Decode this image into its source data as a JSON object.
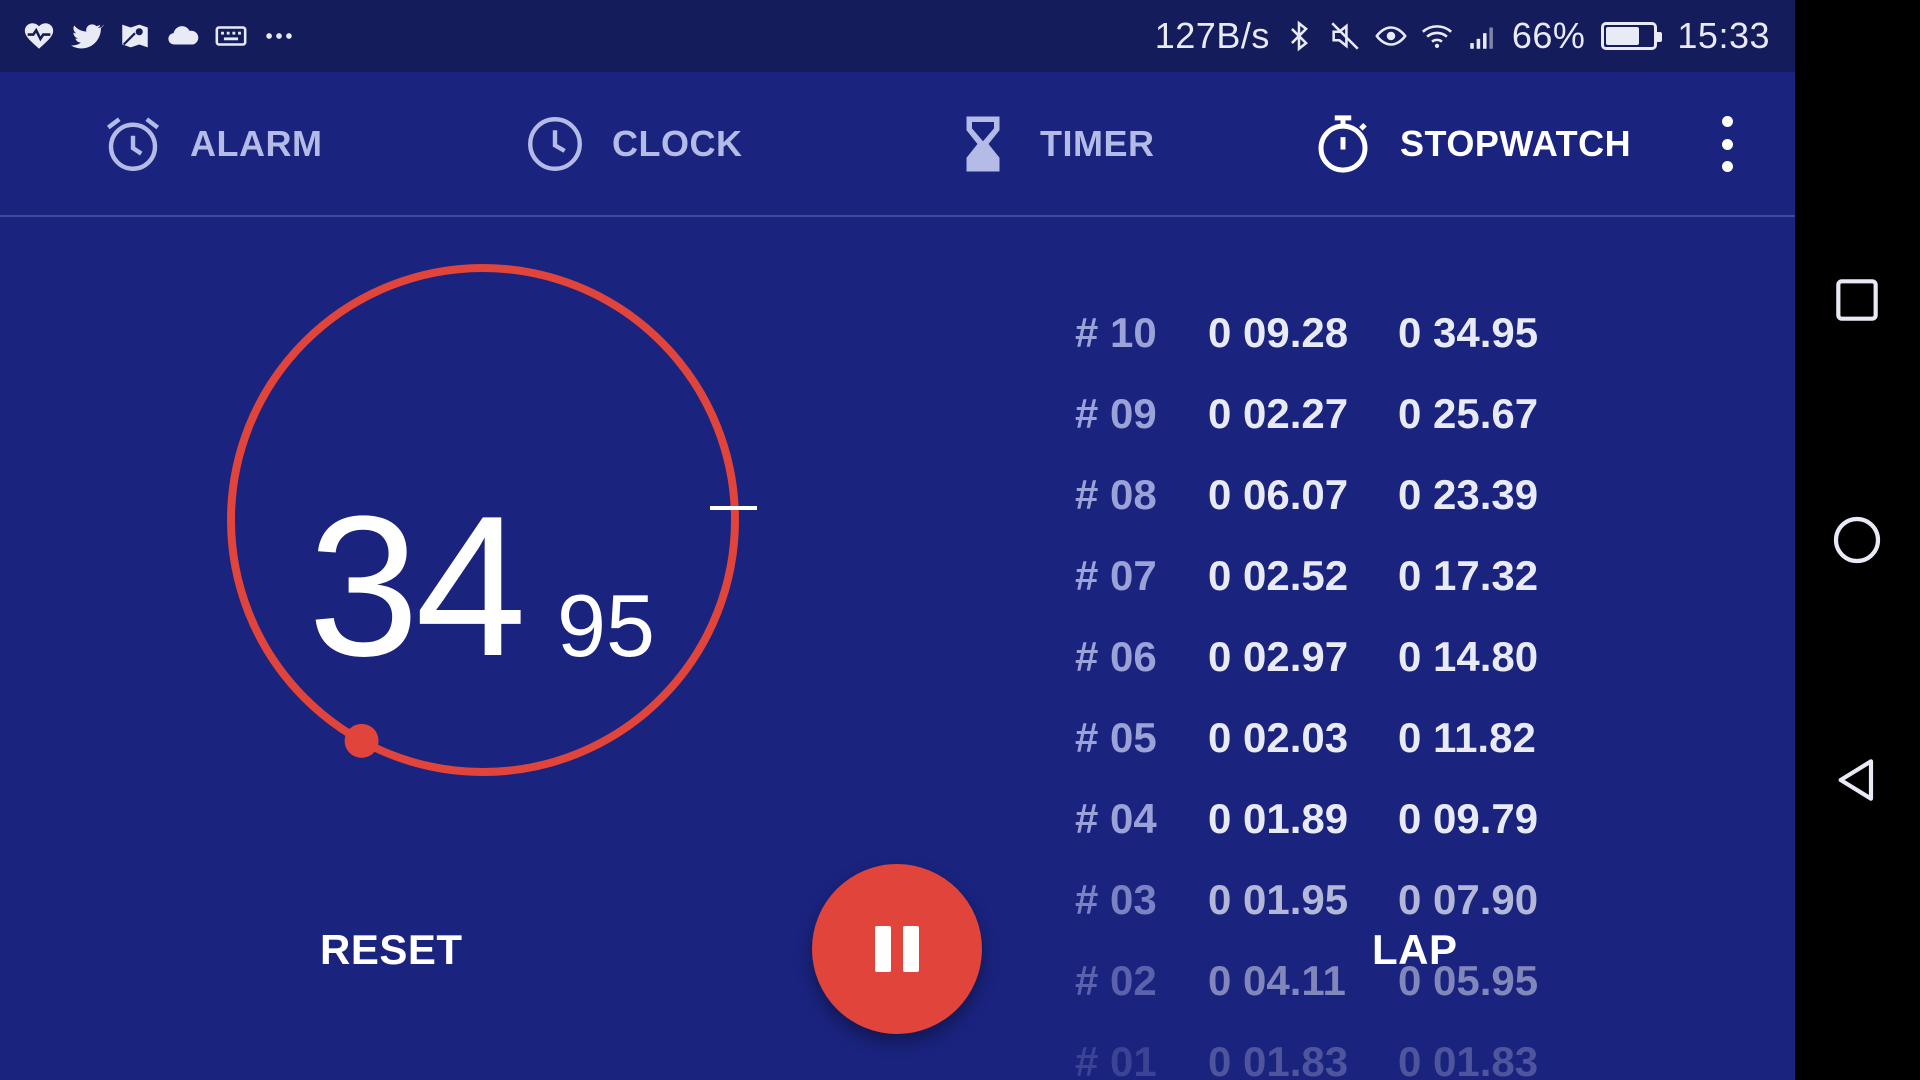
{
  "status_bar": {
    "left_icons": [
      "heart-pulse-icon",
      "twitter-icon",
      "maps-icon",
      "cloud-icon",
      "keyboard-icon",
      "more-dots-icon"
    ],
    "net_speed": "127B/s",
    "battery_percent": "66%",
    "battery_level": 0.66,
    "time": "15:33"
  },
  "tabs": [
    {
      "label": "ALARM",
      "icon": "alarm-icon",
      "active": false
    },
    {
      "label": "CLOCK",
      "icon": "clock-icon",
      "active": false
    },
    {
      "label": "TIMER",
      "icon": "hourglass-icon",
      "active": false
    },
    {
      "label": "STOPWATCH",
      "icon": "stopwatch-icon",
      "active": true
    }
  ],
  "stopwatch": {
    "seconds": "34",
    "hundredths": "95",
    "ring_color": "#e0443a",
    "progress_fraction": 0.58
  },
  "laps": [
    {
      "num": "# 10",
      "split": "0 09.28",
      "total": "0 34.95"
    },
    {
      "num": "# 09",
      "split": "0 02.27",
      "total": "0 25.67"
    },
    {
      "num": "# 08",
      "split": "0 06.07",
      "total": "0 23.39"
    },
    {
      "num": "# 07",
      "split": "0 02.52",
      "total": "0 17.32"
    },
    {
      "num": "# 06",
      "split": "0 02.97",
      "total": "0 14.80"
    },
    {
      "num": "# 05",
      "split": "0 02.03",
      "total": "0 11.82"
    },
    {
      "num": "# 04",
      "split": "0 01.89",
      "total": "0 09.79"
    },
    {
      "num": "# 03",
      "split": "0 01.95",
      "total": "0 07.90"
    },
    {
      "num": "# 02",
      "split": "0 04.11",
      "total": "0 05.95"
    },
    {
      "num": "# 01",
      "split": "0 01.83",
      "total": "0 01.83"
    }
  ],
  "controls": {
    "reset_label": "RESET",
    "lap_label": "LAP",
    "fab_icon": "pause-icon"
  },
  "colors": {
    "background": "#1a237e",
    "status_bar": "#141c5c",
    "accent": "#e0443a"
  }
}
